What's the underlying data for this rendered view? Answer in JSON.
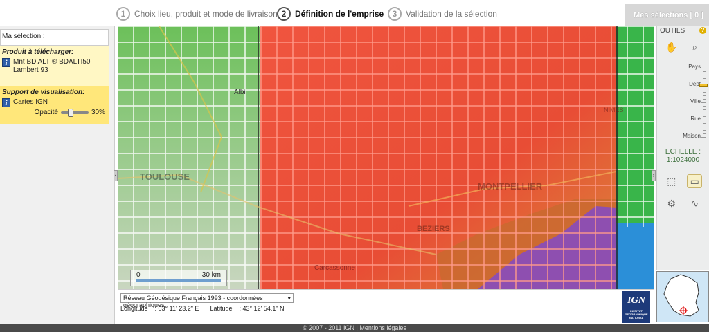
{
  "steps": [
    {
      "num": "1",
      "label": "Choix lieu, produit et mode de livraison"
    },
    {
      "num": "2",
      "label": "Définition de l'emprise"
    },
    {
      "num": "3",
      "label": "Validation de la sélection"
    }
  ],
  "my_selections": "Mes sélections [ 0 ]",
  "left": {
    "selection_title": "Ma sélection :",
    "download_title": "Produit à télécharger:",
    "download_item": "Mnt BD ALTI® BDALTI50 Lambert 93",
    "visual_title": "Support de visualisation:",
    "visual_item": "Cartes IGN",
    "opacity_label": "Opacité",
    "opacity_value": "30%",
    "opacity_fraction": 0.3
  },
  "map": {
    "labels": {
      "albi": "Albi",
      "toulouse": "TOULOUSE",
      "montpellier": "MONTPELLIER",
      "beziers": "BEZIERS",
      "carcassonne": "Carcassonne",
      "nimes": "NIMES"
    }
  },
  "scalebar": {
    "min": "0",
    "max": "30 km"
  },
  "coords": {
    "crs": "Réseau Géodésique Français 1993 - coordonnées géographiques",
    "lon_label": "Longitude",
    "lon_value": ": 03° 11' 23.2\" E",
    "lat_label": "Latitude",
    "lat_value": ": 43° 12' 54.1\" N"
  },
  "tools": {
    "title": "OUTILS",
    "help": "?",
    "zoom_levels": [
      "Pays",
      "Dépt",
      "Ville",
      "Rue",
      "Maison"
    ],
    "zoom_current": "Dépt",
    "echelle_label": "ECHELLE :",
    "echelle_value": "1:1024000"
  },
  "logo": {
    "text": "IGN",
    "sub": "INSTITUT GEOGRAPHIQUE NATIONAL"
  },
  "footer": "© 2007 - 2011 IGN | Mentions légales",
  "colors": {
    "accent": "#f3c12d",
    "selected_tiles": "#f04a3a",
    "sea": "#8e4fb0"
  }
}
